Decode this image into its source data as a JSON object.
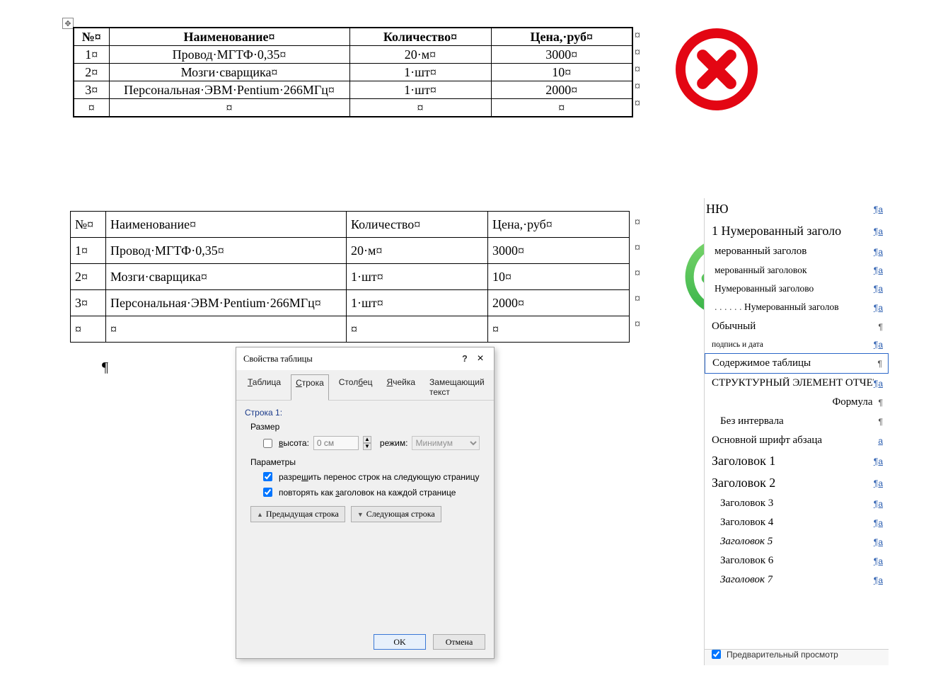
{
  "marks": {
    "cell": "¤",
    "pilcrow": "¶",
    "para_a": "¶a"
  },
  "anchor": "✥",
  "badTable": {
    "headers": [
      "№",
      "Наименование",
      "Количество",
      "Цена,·руб"
    ],
    "rows": [
      [
        "1",
        "Провод·МГТФ·0,35",
        "20·м",
        "3000"
      ],
      [
        "2",
        "Мозги·сварщика",
        "1·шт",
        "10"
      ],
      [
        "3",
        "Персональная·ЭВМ·Pentium·266МГц",
        "1·шт",
        "2000"
      ],
      [
        "",
        "",
        "",
        ""
      ]
    ],
    "colWidths": [
      "50px",
      "340px",
      "200px",
      "200px"
    ]
  },
  "goodTable": {
    "headers": [
      "№",
      "Наименование",
      "Количество",
      "Цена,·руб"
    ],
    "rows": [
      [
        "1",
        "Провод·МГТФ·0,35",
        "20·м",
        "3000"
      ],
      [
        "2",
        "Мозги·сварщика",
        "1·шт",
        "10"
      ],
      [
        "3",
        "Персональная·ЭВМ·Pentium·266МГц",
        "1·шт",
        "2000"
      ],
      [
        "",
        "",
        "",
        ""
      ]
    ],
    "colWidths": [
      "50px",
      "340px",
      "200px",
      "200px"
    ]
  },
  "dialog": {
    "title": "Свойства таблицы",
    "help": "?",
    "close": "×",
    "tabs": {
      "table": "Таблица",
      "row": "Строка",
      "col": "Столбец",
      "cell": "Ячейка",
      "alt": "Замещающий текст"
    },
    "row_label": "Строка 1:",
    "size_label": "Размер",
    "height_label": "высота:",
    "height_value": "0 см",
    "mode_label": "режим:",
    "mode_value": "Минимум",
    "params_label": "Параметры",
    "chk_wrap": "разрешить перенос строк на следующую страницу",
    "chk_repeat": "повторять как заголовок на каждой странице",
    "prev": "Предыдущая строка",
    "next": "Следующая строка",
    "ok": "OK",
    "cancel": "Отмена"
  },
  "stylesPane": {
    "items": [
      {
        "label": "НЮ",
        "mark": "¶a",
        "cls": "cut fam-times sz-big"
      },
      {
        "label": "1  Нумерованный заголо",
        "mark": "¶a",
        "cls": "fam-times sz-big"
      },
      {
        "label": "мерованный заголов",
        "mark": "¶a",
        "cls": "cut fam-times sz-mid",
        "indent": "ind1"
      },
      {
        "label": "мерованный заголовок",
        "mark": "¶a",
        "cls": "cut fam-times",
        "indent": "ind1"
      },
      {
        "label": "Нумерованный заголово",
        "mark": "¶a",
        "cls": "cut fam-times",
        "indent": "ind1"
      },
      {
        "label": "Нумерованный заголов",
        "mark": "¶a",
        "cls": "cut fam-times",
        "dotted": true,
        "indent": "ind1"
      },
      {
        "label": "Обычный",
        "mark": "¶",
        "cls": "fam-times sz-mid"
      },
      {
        "label": "подпись и дата",
        "mark": "¶a",
        "cls": "",
        "small": true
      },
      {
        "label": "Содержимое таблицы",
        "mark": "¶",
        "cls": "fam-times sz-mid",
        "selected": true
      },
      {
        "label": "СТРУКТУРНЫЙ ЭЛЕМЕНТ ОТЧЕТА",
        "mark": "¶a",
        "cls": "fam-times sz-mid"
      },
      {
        "label": "Формула",
        "mark": "¶",
        "cls": "fam-times sz-mid",
        "right": true
      },
      {
        "label": "Без интервала",
        "mark": "¶",
        "cls": "fam-times sz-mid",
        "indent": "ind1"
      },
      {
        "label": "Основной шрифт абзаца",
        "mark": "a",
        "cls": "fam-times sz-mid"
      },
      {
        "label": "Заголовок 1",
        "mark": "¶a",
        "cls": "fam-times sz-big"
      },
      {
        "label": "Заголовок 2",
        "mark": "¶a",
        "cls": "fam-times sz-big"
      },
      {
        "label": "Заголовок 3",
        "mark": "¶a",
        "cls": "fam-times sz-mid",
        "indent": "ind1"
      },
      {
        "label": "Заголовок 4",
        "mark": "¶a",
        "cls": "fam-times sz-mid",
        "indent": "ind1"
      },
      {
        "label": "Заголовок 5",
        "mark": "¶a",
        "cls": "fam-times sz-mid italic",
        "indent": "ind1"
      },
      {
        "label": "Заголовок 6",
        "mark": "¶a",
        "cls": "fam-times sz-mid",
        "indent": "ind1"
      },
      {
        "label": "Заголовок 7",
        "mark": "¶a",
        "cls": "fam-times sz-mid italic",
        "indent": "ind1"
      }
    ],
    "preview": "Предварительный просмотр"
  }
}
